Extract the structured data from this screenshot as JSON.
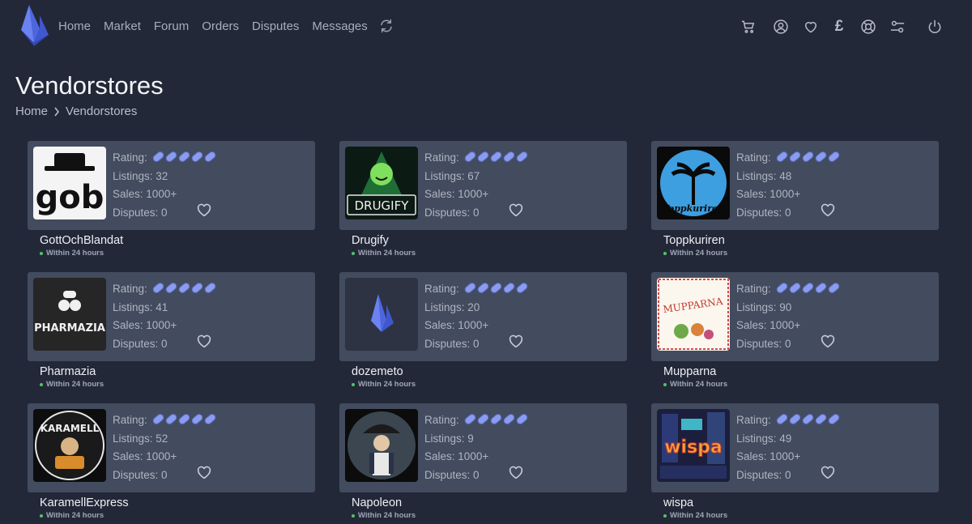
{
  "nav": {
    "links": [
      "Home",
      "Market",
      "Forum",
      "Orders",
      "Disputes",
      "Messages"
    ],
    "icons": [
      "cart-icon",
      "user-icon",
      "heart-icon",
      "pound-icon",
      "lifebuoy-icon",
      "settings-sliders-icon",
      "power-icon"
    ],
    "currency_symbol": "£"
  },
  "page": {
    "title": "Vendorstores",
    "breadcrumb": [
      "Home",
      "Vendorstores"
    ]
  },
  "labels": {
    "rating": "Rating:",
    "listings": "Listings:",
    "sales": "Sales:",
    "disputes": "Disputes:"
  },
  "colors": {
    "background": "#232838",
    "card": "#434b5e",
    "rating_pill": "#8a9cf0",
    "online_dot": "#55c26b"
  },
  "stores": [
    {
      "name": "GottOchBlandat",
      "rating_pills": 5,
      "listings": "32",
      "sales": "1000+",
      "disputes": "0",
      "shipping": "Within 24 hours",
      "logo_text": "gob"
    },
    {
      "name": "Drugify",
      "rating_pills": 5,
      "listings": "67",
      "sales": "1000+",
      "disputes": "0",
      "shipping": "Within 24 hours",
      "logo_text": "DRUGIFY"
    },
    {
      "name": "Toppkuriren",
      "rating_pills": 5,
      "listings": "48",
      "sales": "1000+",
      "disputes": "0",
      "shipping": "Within 24 hours",
      "logo_text": "Toppkuriren"
    },
    {
      "name": "Pharmazia",
      "rating_pills": 5,
      "listings": "41",
      "sales": "1000+",
      "disputes": "0",
      "shipping": "Within 24 hours",
      "logo_text": "PHARMAZIA"
    },
    {
      "name": "dozemeto",
      "rating_pills": 5,
      "listings": "20",
      "sales": "1000+",
      "disputes": "0",
      "shipping": "Within 24 hours",
      "logo_text": ""
    },
    {
      "name": "Mupparna",
      "rating_pills": 5,
      "listings": "90",
      "sales": "1000+",
      "disputes": "0",
      "shipping": "Within 24 hours",
      "logo_text": "MUPPARNA"
    },
    {
      "name": "KaramellExpress",
      "rating_pills": 5,
      "listings": "52",
      "sales": "1000+",
      "disputes": "0",
      "shipping": "Within 24 hours",
      "logo_text": "KARAMELL"
    },
    {
      "name": "Napoleon",
      "rating_pills": 5,
      "listings": "9",
      "sales": "1000+",
      "disputes": "0",
      "shipping": "Within 24 hours",
      "logo_text": ""
    },
    {
      "name": "wispa",
      "rating_pills": 5,
      "listings": "49",
      "sales": "1000+",
      "disputes": "0",
      "shipping": "Within 24 hours",
      "logo_text": "wispa"
    }
  ]
}
